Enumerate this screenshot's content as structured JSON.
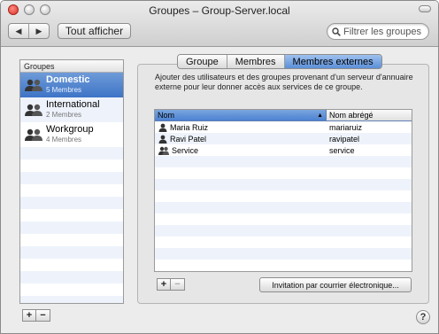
{
  "window": {
    "title": "Groupes – Group-Server.local",
    "show_all_label": "Tout afficher"
  },
  "search": {
    "placeholder": "Filtrer les groupes"
  },
  "group_list": {
    "header": "Groupes",
    "groups": [
      {
        "name": "Domestic",
        "count": "5 Membres",
        "selected": true
      },
      {
        "name": "International",
        "count": "2 Membres",
        "selected": false
      },
      {
        "name": "Workgroup",
        "count": "4 Membres",
        "selected": false
      }
    ]
  },
  "tabs": [
    {
      "label": "Groupe",
      "active": false
    },
    {
      "label": "Membres",
      "active": false
    },
    {
      "label": "Membres externes",
      "active": true
    }
  ],
  "description": "Ajouter des utilisateurs et des groupes provenant d'un serveur d'annuaire externe pour leur donner accès aux services de ce groupe.",
  "members_table": {
    "columns": [
      "Nom",
      "Nom abrégé"
    ],
    "rows": [
      {
        "name": "Maria Ruiz",
        "short": "mariaruiz",
        "icon": "person-icon"
      },
      {
        "name": "Ravi Patel",
        "short": "ravipatel",
        "icon": "person-icon"
      },
      {
        "name": "Service",
        "short": "service",
        "icon": "group-icon"
      }
    ]
  },
  "buttons": {
    "add": "+",
    "remove": "−",
    "invite": "Invitation par courrier électronique...",
    "help": "?"
  },
  "colors": {
    "selection": "#4a7fcd",
    "close_light": "#d8342a"
  }
}
